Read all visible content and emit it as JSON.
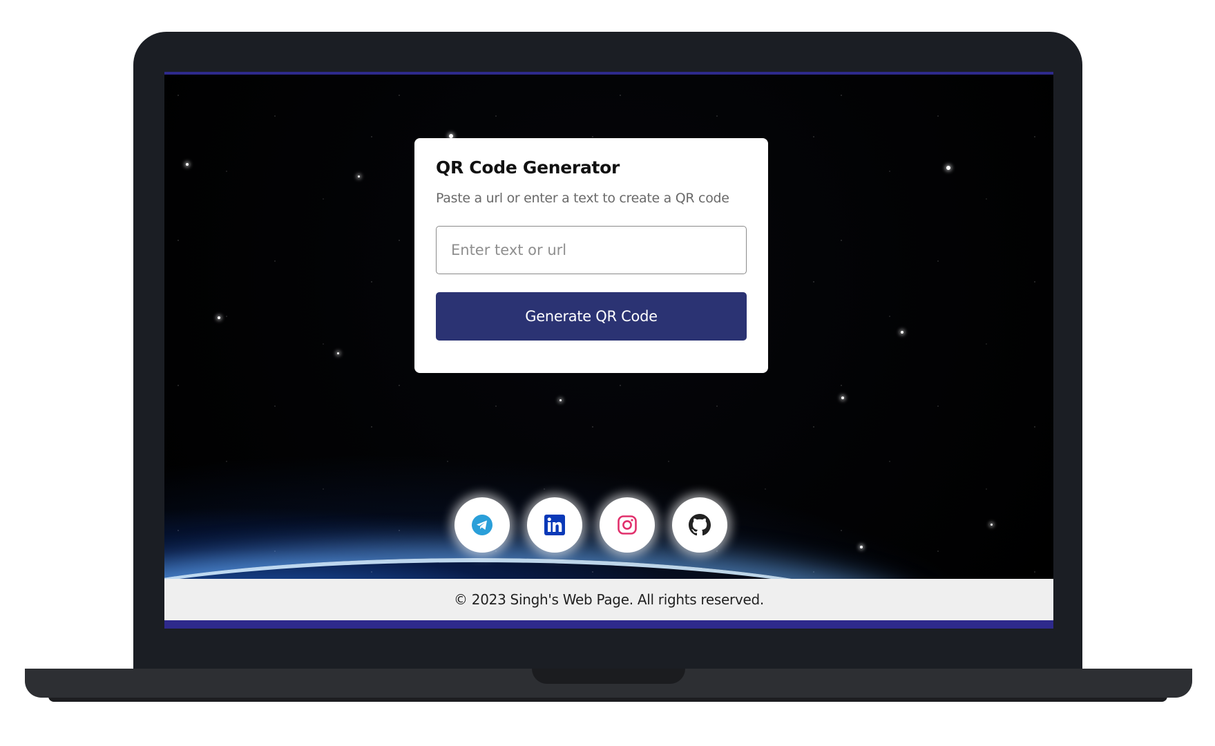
{
  "card": {
    "title": "QR Code Generator",
    "subtitle": "Paste a url or enter a text to create a QR code",
    "input_placeholder": "Enter text or url",
    "input_value": "",
    "button_label": "Generate QR Code"
  },
  "socials": [
    {
      "icon": "telegram-icon",
      "color": "#2a9fd9"
    },
    {
      "icon": "linkedin-icon",
      "color": "#0a39b8"
    },
    {
      "icon": "instagram-icon",
      "color": "#e1306c"
    },
    {
      "icon": "github-icon",
      "color": "#222222"
    }
  ],
  "footer": {
    "text": "© 2023 Singh's Web Page. All rights reserved."
  },
  "colors": {
    "primary": "#2b3373",
    "accent_bar": "#2e2a8c",
    "footer_bg": "#efefef"
  }
}
